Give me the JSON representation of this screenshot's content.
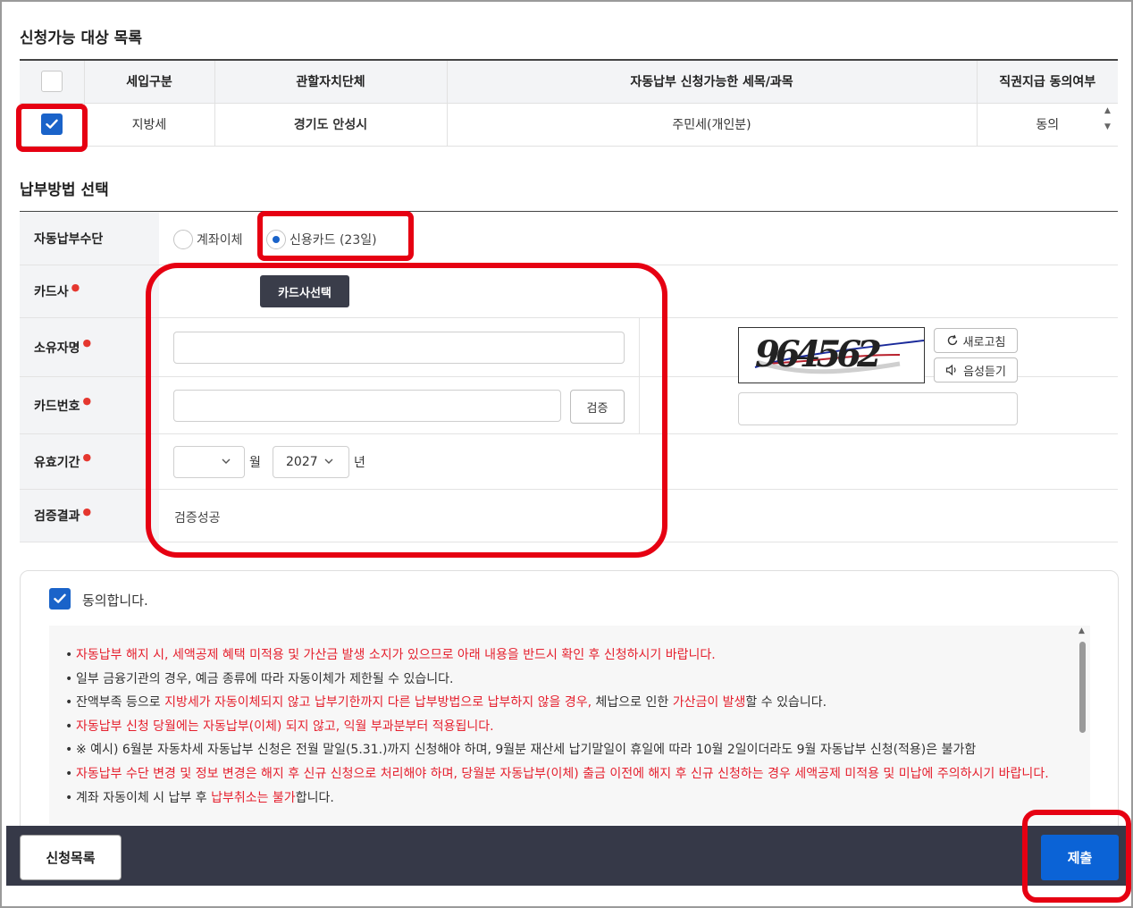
{
  "target_section": {
    "title": "신청가능 대상 목록",
    "columns": [
      "세입구분",
      "관할자치단체",
      "자동납부 신청가능한 세목/과목",
      "직권지급 동의여부"
    ],
    "rows": [
      {
        "checked": true,
        "tax_type": "지방세",
        "authority": "경기도 안성시",
        "item": "주민세(개인분)",
        "consent": "동의"
      }
    ]
  },
  "payment_section": {
    "title": "납부방법 선택",
    "method_label": "자동납부수단",
    "methods": [
      {
        "label": "계좌이체",
        "selected": false
      },
      {
        "label": "신용카드 (23일)",
        "selected": true
      }
    ],
    "card_company_label": "카드사",
    "card_company_button": "카드사선택",
    "owner_label": "소유자명",
    "owner_value": "",
    "card_number_label": "카드번호",
    "card_number_value": "",
    "verify_button": "검증",
    "expiry_label": "유효기간",
    "expiry_month": "",
    "month_unit": "월",
    "expiry_year": "2027",
    "year_unit": "년",
    "result_label": "검증결과",
    "result_value": "검증성공"
  },
  "captcha": {
    "code": "964562",
    "refresh_button": "새로고침",
    "audio_button": "음성듣기",
    "input_value": ""
  },
  "agreement": {
    "checked": true,
    "label": "동의합니다.",
    "notices": [
      {
        "parts": [
          {
            "text": "자동납부 해지 시, 세액공제 혜택 미적용 및 가산금 발생 소지가 있으므로 아래 내용을 반드시 확인 후 신청하시기 바랍니다.",
            "red": true
          }
        ]
      },
      {
        "parts": [
          {
            "text": "일부 금융기관의 경우, 예금 종류에 따라 자동이체가 제한될 수 있습니다.",
            "red": false
          }
        ]
      },
      {
        "parts": [
          {
            "text": "잔액부족 등으로 ",
            "red": false
          },
          {
            "text": "지방세가 자동이체되지 않고 납부기한까지 다른 납부방법으로 납부하지 않을 경우,",
            "red": true
          },
          {
            "text": " 체납으로 인한 ",
            "red": false
          },
          {
            "text": "가산금이 발생",
            "red": true
          },
          {
            "text": "할 수 있습니다.",
            "red": false
          }
        ]
      },
      {
        "parts": [
          {
            "text": "자동납부 신청 당월에는 자동납부(이체) 되지 않고, 익월 부과분부터 적용됩니다.",
            "red": true
          }
        ]
      },
      {
        "parts": [
          {
            "text": "※ 예시) 6월분 자동차세 자동납부 신청은 전월 말일(5.31.)까지 신청해야 하며, 9월분 재산세 납기말일이 휴일에 따라 10월 2일이더라도 9월 자동납부 신청(적용)은 불가함",
            "red": false
          }
        ]
      },
      {
        "parts": [
          {
            "text": "자동납부 수단 변경 및 정보 변경은 해지 후 신규 신청으로 처리해야 하며, 당월분 자동납부(이체) 출금 이전에 해지 후 신규 신청하는 경우 세액공제 미적용 및 미납에 주의하시기 바랍니다.",
            "red": true
          }
        ]
      },
      {
        "parts": [
          {
            "text": "계좌 자동이체 시 납부 후 ",
            "red": false
          },
          {
            "text": "납부취소는 불가",
            "red": true
          },
          {
            "text": "합니다.",
            "red": false
          }
        ]
      }
    ]
  },
  "footer": {
    "list_button": "신청목록",
    "submit_button": "제출"
  },
  "colors": {
    "accent": "#1a63c9",
    "submit": "#0b63d6",
    "bottom_bar": "#363948",
    "highlight": "#e60012",
    "notice_red": "#e5202e"
  }
}
